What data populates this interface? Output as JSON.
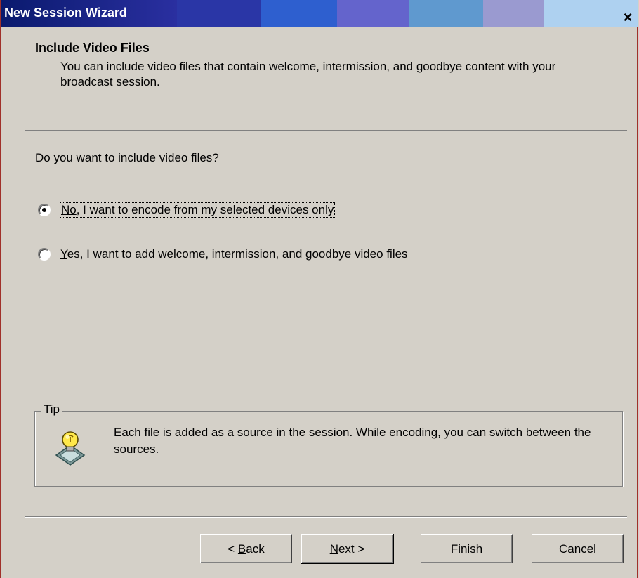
{
  "window": {
    "title": "New Session Wizard",
    "close_glyph": "×",
    "titlebar_colors": [
      "#1b2b84",
      "#2a2fa0",
      "#2e5fcf",
      "#6464cc",
      "#5f99cf",
      "#9a9ad0",
      "#aed1f0"
    ]
  },
  "header": {
    "title": "Include Video Files",
    "description": "You can include video files that contain welcome, intermission, and goodbye content with your broadcast session."
  },
  "question": "Do you want to include video files?",
  "options": [
    {
      "accel": "No",
      "rest": ", I want to encode from my selected devices only",
      "checked": true
    },
    {
      "accel": "Y",
      "rest": "es, I want to add welcome, intermission, and goodbye video files",
      "checked": false
    }
  ],
  "tip": {
    "legend": "Tip",
    "icon": "lightbulb-tip-icon",
    "text": "Each file is added as a source in the session. While encoding, you can switch between the sources."
  },
  "buttons": {
    "back_prefix": "< ",
    "back_accel": "B",
    "back_rest": "ack",
    "next_accel": "N",
    "next_rest": "ext >",
    "finish": "Finish",
    "cancel": "Cancel"
  }
}
